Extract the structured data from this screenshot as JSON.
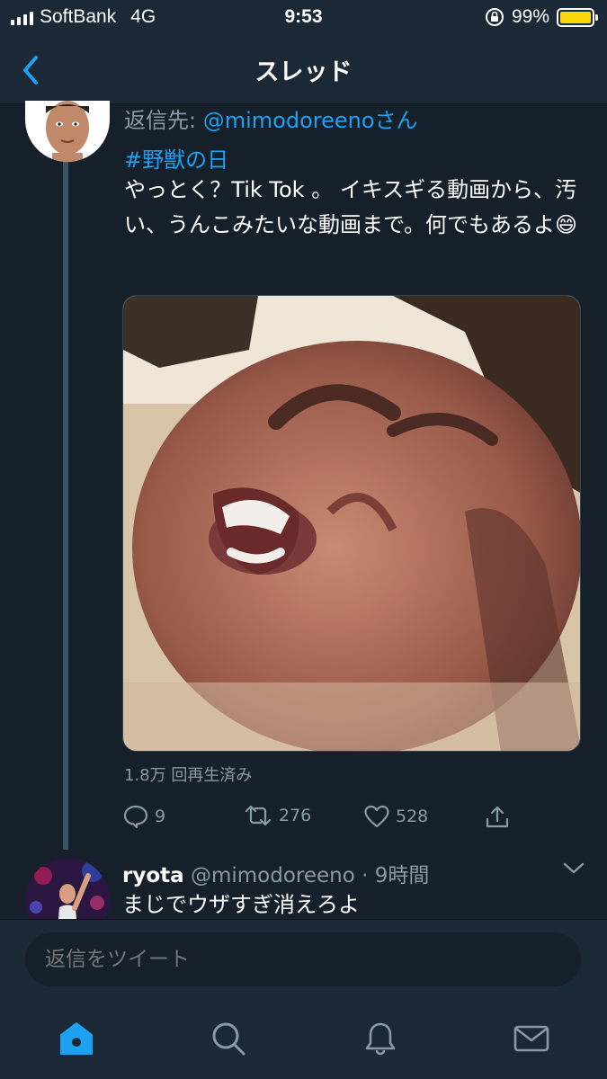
{
  "status_bar": {
    "carrier": "SoftBank",
    "network": "4G",
    "time": "9:53",
    "battery": "99%",
    "battery_level": 0.99,
    "battery_color": "#ffd60a"
  },
  "nav": {
    "title": "スレッド",
    "back_icon": "chevron-left-icon"
  },
  "tweet": {
    "reply_prefix": "返信先: ",
    "reply_handle": "@mimodoreenoさん",
    "hashtag": "#野獣の日",
    "text": "やっとく？Tik Tok 。 イキスギる動画から、汚い、うんこみたいな動画まで。何でもあるよ😄",
    "views": "1.8万 回再生済み",
    "replies": "9",
    "retweets": "276",
    "likes": "528"
  },
  "reply": {
    "name": "ryota",
    "meta": "@mimodoreeno · 9時間",
    "text": "まじでウザすぎ消えろよ"
  },
  "composer": {
    "placeholder": "返信をツイート"
  },
  "tabs": [
    "home-icon",
    "search-icon",
    "bell-icon",
    "mail-icon"
  ],
  "colors": {
    "background": "#15202b",
    "bar": "#1b2836",
    "accent": "#1da1f2",
    "muted": "#8899a6"
  }
}
